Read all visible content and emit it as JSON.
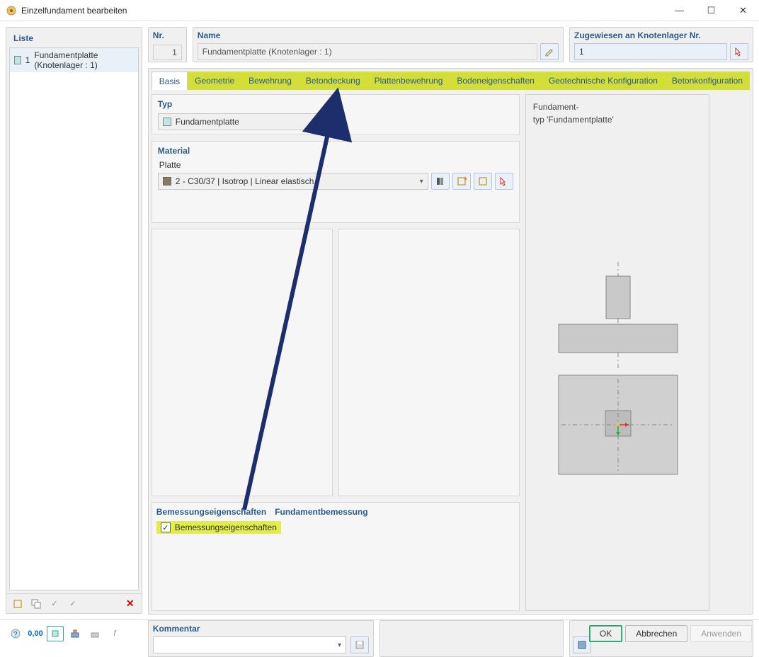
{
  "window": {
    "title": "Einzelfundament bearbeiten"
  },
  "list": {
    "header": "Liste",
    "items": [
      {
        "num": "1",
        "label": "Fundamentplatte (Knotenlager : 1)"
      }
    ]
  },
  "nr": {
    "label": "Nr.",
    "value": "1"
  },
  "name": {
    "label": "Name",
    "value": "Fundamentplatte (Knotenlager : 1)"
  },
  "assigned": {
    "label": "Zugewiesen an Knotenlager Nr.",
    "value": "1"
  },
  "tabs": {
    "basis": "Basis",
    "geometrie": "Geometrie",
    "bewehrung": "Bewehrung",
    "betondeckung": "Betondeckung",
    "plattenbewehrung": "Plattenbewehrung",
    "bodeneigenschaften": "Bodeneigenschaften",
    "geotech": "Geotechnische Konfiguration",
    "betonkonfig": "Betonkonfiguration"
  },
  "typ": {
    "label": "Typ",
    "value": "Fundamentplatte"
  },
  "material": {
    "label": "Material",
    "plate_label": "Platte",
    "value": "2 - C30/37 | Isotrop | Linear elastisch"
  },
  "design": {
    "header1": "Bemessungseigenschaften",
    "header2": "Fundamentbemessung",
    "checkbox_label": "Bemessungseigenschaften"
  },
  "preview": {
    "line1": "Fundament-",
    "line2": "typ 'Fundamentplatte'"
  },
  "comment": {
    "label": "Kommentar",
    "value": ""
  },
  "buttons": {
    "ok": "OK",
    "cancel": "Abbrechen",
    "apply": "Anwenden"
  }
}
